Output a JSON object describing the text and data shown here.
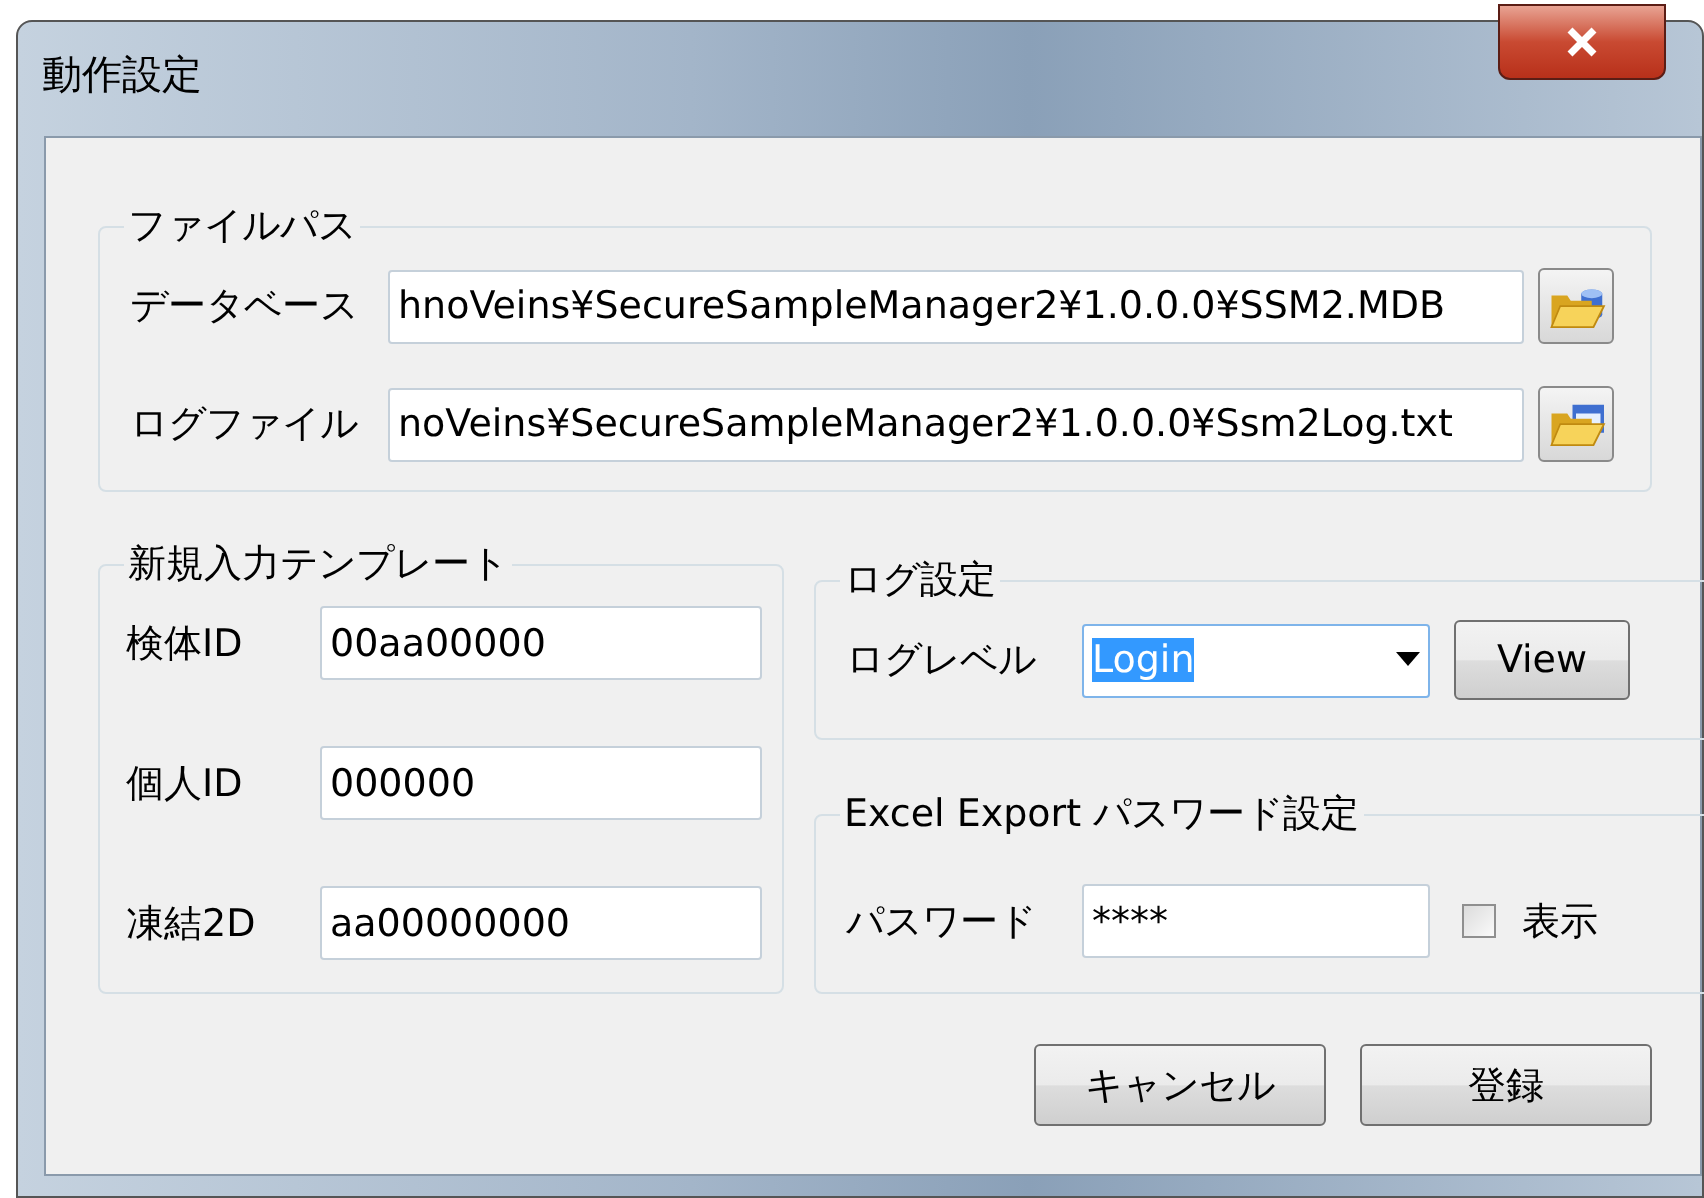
{
  "window": {
    "title": "動作設定"
  },
  "file_path": {
    "title": "ファイルパス",
    "rows": [
      {
        "label": "データベース",
        "value": "hnoVeins¥SecureSampleManager2¥1.0.0.0¥SSM2.MDB",
        "kind": "database"
      },
      {
        "label": "ログファイル",
        "value": "noVeins¥SecureSampleManager2¥1.0.0.0¥Ssm2Log.txt",
        "kind": "window"
      }
    ]
  },
  "template": {
    "title": "新規入力テンプレート",
    "fields": [
      {
        "label": "検体ID",
        "value": "00aa00000"
      },
      {
        "label": "個人ID",
        "value": "000000"
      },
      {
        "label": "凍結2D",
        "value": "aa00000000"
      }
    ]
  },
  "log": {
    "title": "ログ設定",
    "label": "ログレベル",
    "value": "Login",
    "text_selected": true,
    "button": "View"
  },
  "export": {
    "title": "Excel Export パスワード設定",
    "label": "パスワード",
    "value": "****",
    "checkbox": {
      "label": "表示",
      "checked": false
    }
  },
  "buttons": [
    "キャンセル",
    "登録"
  ]
}
